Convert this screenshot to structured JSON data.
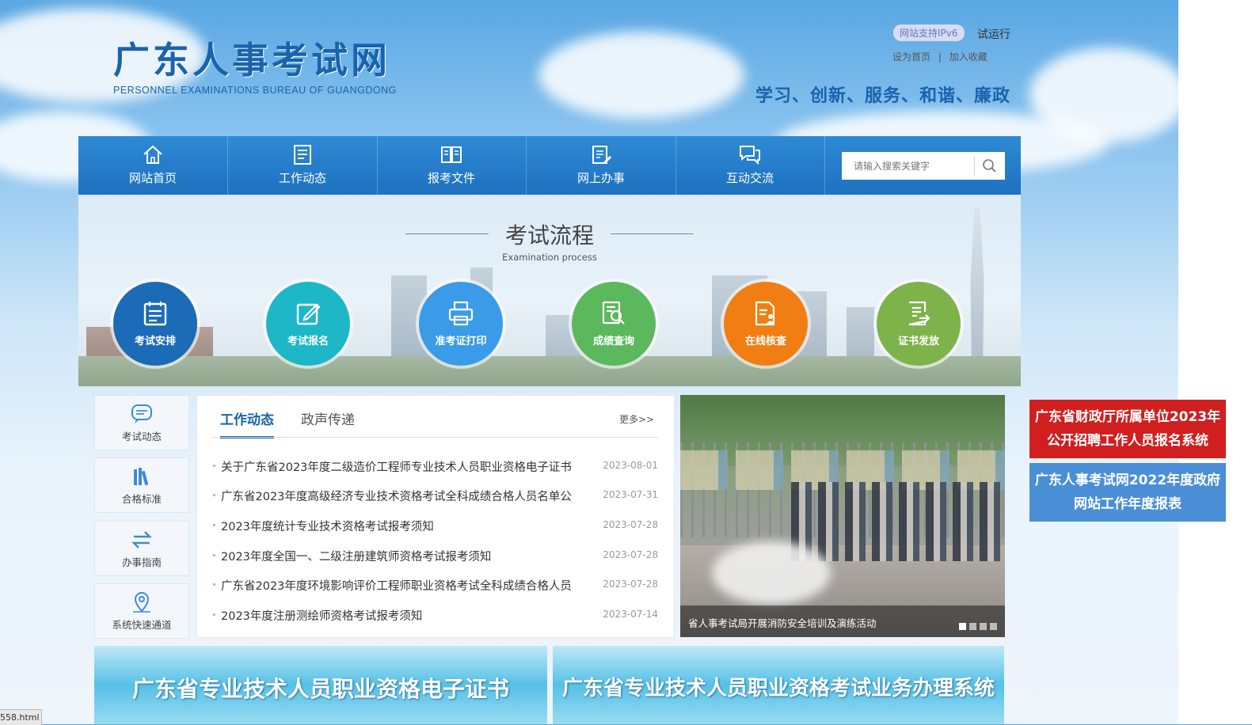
{
  "header": {
    "site_title": "广东人事考试网",
    "site_subtitle": "PERSONNEL EXAMINATIONS BUREAU OF GUANGDONG",
    "ipv6_badge": "网站支持IPv6",
    "trial_label": "试运行",
    "links": [
      "设为首页",
      "|",
      "加入收藏"
    ],
    "slogan": "学习、创新、服务、和谐、廉政"
  },
  "nav": {
    "items": [
      {
        "label": "网站首页",
        "icon": "home-icon"
      },
      {
        "label": "工作动态",
        "icon": "document-icon"
      },
      {
        "label": "报考文件",
        "icon": "book-icon"
      },
      {
        "label": "网上办事",
        "icon": "edit-document-icon"
      },
      {
        "label": "互动交流",
        "icon": "chat-icon"
      }
    ],
    "search_placeholder": "请输入搜索关键字"
  },
  "flow": {
    "title": "考试流程",
    "subtitle": "Examination process",
    "steps": [
      {
        "label": "考试安排",
        "color": "#1c6bb6"
      },
      {
        "label": "考试报名",
        "color": "#1db7c8"
      },
      {
        "label": "准考证打印",
        "color": "#3a9be8"
      },
      {
        "label": "成绩查询",
        "color": "#5cb85c"
      },
      {
        "label": "在线核查",
        "color": "#f17e12"
      },
      {
        "label": "证书发放",
        "color": "#7db34a"
      }
    ]
  },
  "sidebar": {
    "items": [
      {
        "label": "考试动态",
        "icon": "chat-bubble-icon"
      },
      {
        "label": "合格标准",
        "icon": "books-icon"
      },
      {
        "label": "办事指南",
        "icon": "swap-arrows-icon"
      },
      {
        "label": "系统快速通道",
        "icon": "location-pin-icon"
      }
    ]
  },
  "news": {
    "tabs": [
      "工作动态",
      "政声传递"
    ],
    "more": "更多>>",
    "items": [
      {
        "title": "关于广东省2023年度二级造价工程师专业技术人员职业资格电子证书",
        "date": "2023-08-01"
      },
      {
        "title": "广东省2023年度高级经济专业技术资格考试全科成绩合格人员名单公",
        "date": "2023-07-31"
      },
      {
        "title": "2023年度统计专业技术资格考试报考须知",
        "date": "2023-07-28"
      },
      {
        "title": "2023年度全国一、二级注册建筑师资格考试报考须知",
        "date": "2023-07-28"
      },
      {
        "title": "广东省2023年度环境影响评价工程师职业资格考试全科成绩合格人员",
        "date": "2023-07-28"
      },
      {
        "title": "2023年度注册测绘师资格考试报考须知",
        "date": "2023-07-14"
      }
    ]
  },
  "photo": {
    "caption": "省人事考试局开展消防安全培训及演练活动",
    "slide_count": 4,
    "active_slide": 1
  },
  "right_buttons": [
    {
      "text": "广东省财政厅所属单位2023年公开招聘工作人员报名系统",
      "color": "#d11f1f"
    },
    {
      "text": "广东人事考试网2022年度政府网站工作年度报表",
      "color": "#4a8fd6"
    }
  ],
  "bottom_banners": [
    {
      "text": "广东省专业技术人员职业资格电子证书"
    },
    {
      "text": "广东省专业技术人员职业资格考试业务办理系统"
    }
  ],
  "statusbar": {
    "text": "558.html"
  }
}
